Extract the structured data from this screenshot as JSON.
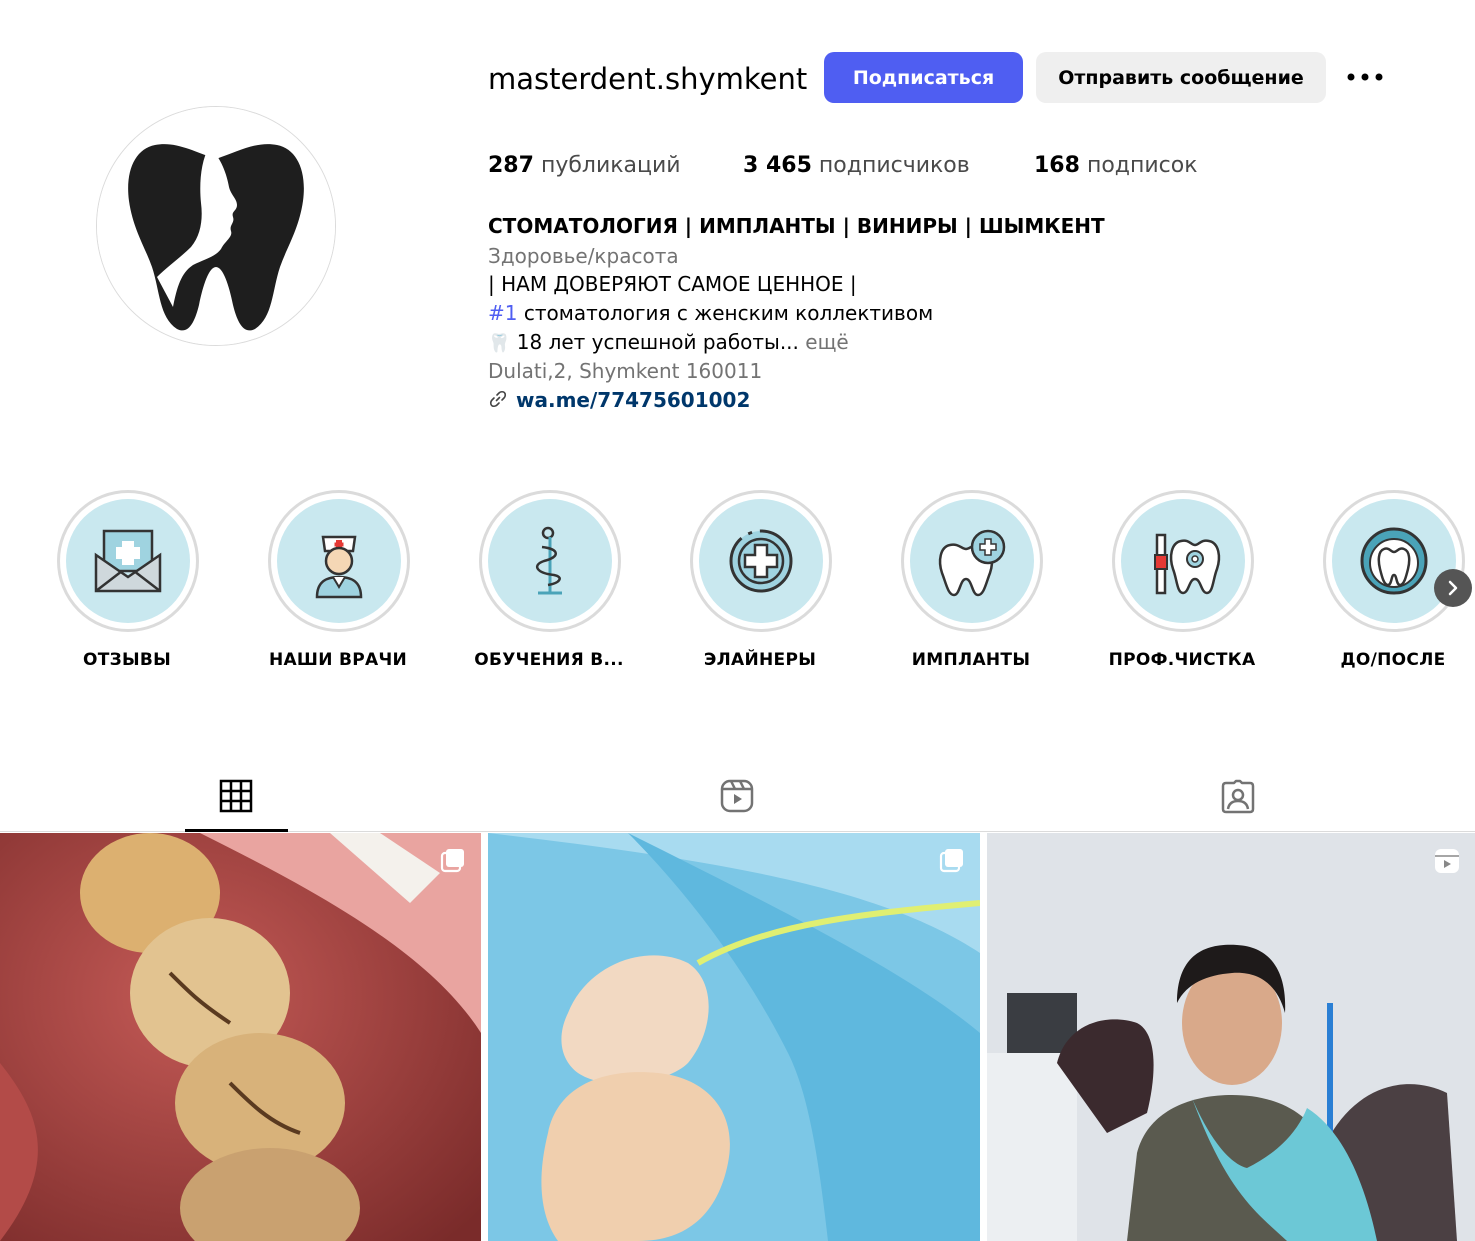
{
  "profile": {
    "username": "masterdent.shymkent",
    "follow_label": "Подписаться",
    "message_label": "Отправить сообщение",
    "more_icon": "more-horizontal-icon"
  },
  "stats": {
    "posts_count": "287",
    "posts_label": "публикаций",
    "followers_count": "3 465",
    "followers_label": "подписчиков",
    "following_count": "168",
    "following_label": "подписок"
  },
  "bio": {
    "title": "СТОМАТОЛОГИЯ | ИМПЛАНТЫ | ВИНИРЫ | ШЫМКЕНТ",
    "category": "Здоровье/красота",
    "line1": "| НАМ ДОВЕРЯЮТ САМОЕ ЦЕННОЕ |",
    "line2_tag": "#1",
    "line2_text": " стоматология с женским коллективом",
    "line3_emoji": "🦷",
    "line3_text": "18 лет успешной работы...",
    "line3_more": " ещё",
    "address": "Dulati,2, Shymkent 160011",
    "link": "wa.me/77475601002"
  },
  "highlights": [
    {
      "label": "ОТЗЫВЫ",
      "icon": "envelope-medical-icon"
    },
    {
      "label": "НАШИ ВРАЧИ",
      "icon": "nurse-icon"
    },
    {
      "label": "ОБУЧЕНИЯ В...",
      "icon": "caduceus-icon"
    },
    {
      "label": "ЭЛАЙНЕРЫ",
      "icon": "medical-cross-icon"
    },
    {
      "label": "ИМПЛАНТЫ",
      "icon": "tooth-plus-icon"
    },
    {
      "label": "ПРОФ.ЧИСТКА",
      "icon": "tooth-cleaning-icon"
    },
    {
      "label": "ДО/ПОСЛЕ",
      "icon": "tooth-circle-icon"
    }
  ],
  "tabs": [
    {
      "name": "posts",
      "icon": "grid-icon",
      "active": true
    },
    {
      "name": "reels",
      "icon": "reels-icon",
      "active": false
    },
    {
      "name": "tagged",
      "icon": "tagged-user-icon",
      "active": false
    }
  ],
  "posts": [
    {
      "type": "carousel",
      "badge_icon": "carousel-icon"
    },
    {
      "type": "carousel",
      "badge_icon": "carousel-icon"
    },
    {
      "type": "reel",
      "badge_icon": "reel-icon"
    }
  ],
  "colors": {
    "accent": "#4f5ef2",
    "highlight_bg": "#c9e8ef",
    "link": "#00376b",
    "muted": "#737373"
  }
}
